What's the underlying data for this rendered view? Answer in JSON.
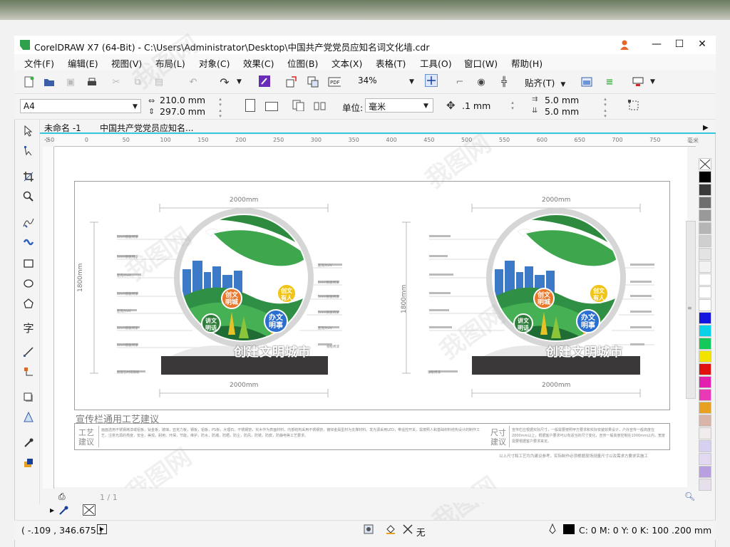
{
  "window": {
    "title": "CorelDRAW X7 (64-Bit) - C:\\Users\\Administrator\\Desktop\\中国共产党党员应知名词文化墙.cdr",
    "controls": {
      "minimize": "—",
      "maximize": "☐",
      "close": "✕"
    }
  },
  "menubar": {
    "items": [
      "文件(F)",
      "编辑(E)",
      "视图(V)",
      "布局(L)",
      "对象(C)",
      "效果(C)",
      "位图(B)",
      "文本(X)",
      "表格(T)",
      "工具(O)",
      "窗口(W)",
      "帮助(H)"
    ]
  },
  "toolbar1": {
    "zoom": "34%",
    "snap_label": "贴齐(T)"
  },
  "toolbar2": {
    "paper": "A4",
    "width": "210.0 mm",
    "height": "297.0 mm",
    "unit_label": "单位:",
    "unit_value": "毫米",
    "nudge": ".1 mm",
    "dup_x": "5.0 mm",
    "dup_y": "5.0 mm"
  },
  "tabs": [
    "未命名 -1",
    "中国共产党党员应知名..."
  ],
  "ruler": {
    "top_ticks": [
      "50",
      "0",
      "50",
      "100",
      "150",
      "200",
      "250",
      "300",
      "350",
      "400",
      "450",
      "500",
      "550",
      "600",
      "650",
      "700",
      "750",
      "毫米"
    ]
  },
  "drawing": {
    "dim_width": "2000mm",
    "dim_height": "1800mm",
    "slogan": "创建文明城市",
    "badges": [
      {
        "text": "创文\n明城",
        "color": "#e8772a"
      },
      {
        "text": "创文\n有人",
        "color": "#f0c419"
      },
      {
        "text": "讲文\n明话",
        "color": "#2f7d3a"
      },
      {
        "text": "办文\n明事",
        "color": "#2a6fd0"
      }
    ],
    "section_title": "宣传栏通用工艺建议",
    "craft_label": "工艺\n建议",
    "size_label": "尺寸\n建议",
    "craft_text": "画面选用不锈钢烤漆或铝板，钛金板，玻璃，亚克力板，钢板，铝板，PS板，大理石，不锈钢管，实木作为表面材料，内部结构采用不锈钢管，镀锌金属型材为支撑材料。发光源采用LED，带遥控开关，需按照人和基础材料结构设计的制作工艺，注意光源的亮度，安全，美观，耐用，环保，节能，维护，防水，防潮，防晒，防尘，防风，防锈，防腐，防静电等工艺要求。",
    "size_text": "宣传栏应根据实际尺寸，一般需要按照甲方要求和实际安装效果设计，户外宣传一般高度在2000mm以上，根据客户要求可以有适当的尺寸变化，宣传一般高度控制在1000mm以内，宽度需要根据客户要求来定。",
    "size_note": "以上尺寸和工艺均为建议参考，实际制作必须根据现场测量尺寸以及需求方要求实施工",
    "left_notes": [
      "5mm钢板烤漆",
      "5mm钢板烤漆",
      "亚克力UV",
      "5mm钢板烤漆",
      "亚克力UV",
      "5mm钢板烤漆",
      "5mm钢板烤漆",
      "钢板烤漆"
    ],
    "right_notes": [
      "亚克力UV",
      "5mm钢板烤漆",
      "5mm钢板烤漆",
      "5mm钢板烤漆",
      "亚克力UV",
      "钢板烤漆"
    ],
    "bottom_note": "底座石材或钢板"
  },
  "palette": {
    "colors": [
      "#000000",
      "#3a3a3a",
      "#6e6e6e",
      "#999999",
      "#b5b5b5",
      "#cfcfcf",
      "#e3e3e3",
      "#f2f2f2",
      "#ffffff",
      "#ffffff",
      "#ffffff",
      "#1515e0",
      "#0ad0e8",
      "#12c95a",
      "#f3e400",
      "#e01010",
      "#e21fae",
      "#e83ab5",
      "#e8a020",
      "#d8b5a8",
      "#f0ecec",
      "#d8d0f0",
      "#e2d8f0",
      "#b8a0e0",
      "#e6e0ec"
    ]
  },
  "bottom_nav": {
    "page_counter": "1 / 1"
  },
  "status": {
    "coordinates": "( -.109 , 346.675 )",
    "fill_none": "无",
    "outline": "C: 0 M: 0 Y: 0 K: 100 .200 mm"
  },
  "watermark": "我图网"
}
